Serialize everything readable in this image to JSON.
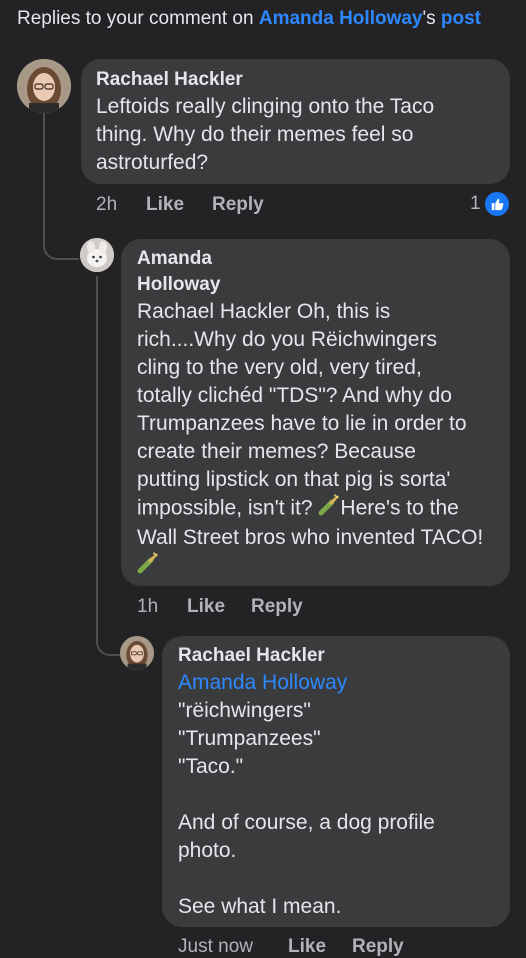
{
  "header": {
    "prefix": "Replies to your comment on ",
    "link": "Amanda Holloway",
    "suffix": "'s ",
    "post": "post"
  },
  "comments": [
    {
      "author": "Rachael Hackler",
      "text": "Leftoids really clinging onto the Taco\nthing. Why do their memes feel so\nastroturfed?",
      "time": "2h",
      "like": "Like",
      "reply": "Reply",
      "reaction_count": "1",
      "reaction_icon": "thumbs-up-icon"
    },
    {
      "author_line1": "Amanda",
      "author_line2": "Holloway",
      "text": "Rachael Hackler Oh, this is\nrich....Why do you Rëichwingers\ncling to the very old, very tired,\ntotally clichéd \"TDS\"? And why do\nTrumpanzees have to lie in order to\ncreate their memes? Because\nputting lipstick on that pig is sorta'\nimpossible, isn't it? ",
      "text_after_emoji": "Here's to the\nWall Street bros who invented TACO!",
      "emoji": "champagne-icon",
      "time": "1h",
      "like": "Like",
      "reply": "Reply"
    },
    {
      "author": "Rachael Hackler",
      "mention": "Amanda Holloway",
      "text": "\"rëichwingers\"\n\"Trumpanzees\"\n\"Taco.\"\n\nAnd of course, a dog profile\nphoto.\n\nSee what I mean.",
      "time": "Just now",
      "like": "Like",
      "reply": "Reply"
    }
  ],
  "colors": {
    "background": "#232325",
    "bubble": "#3a3b3c",
    "link": "#2d88ff",
    "muted": "#b0b3b8"
  }
}
